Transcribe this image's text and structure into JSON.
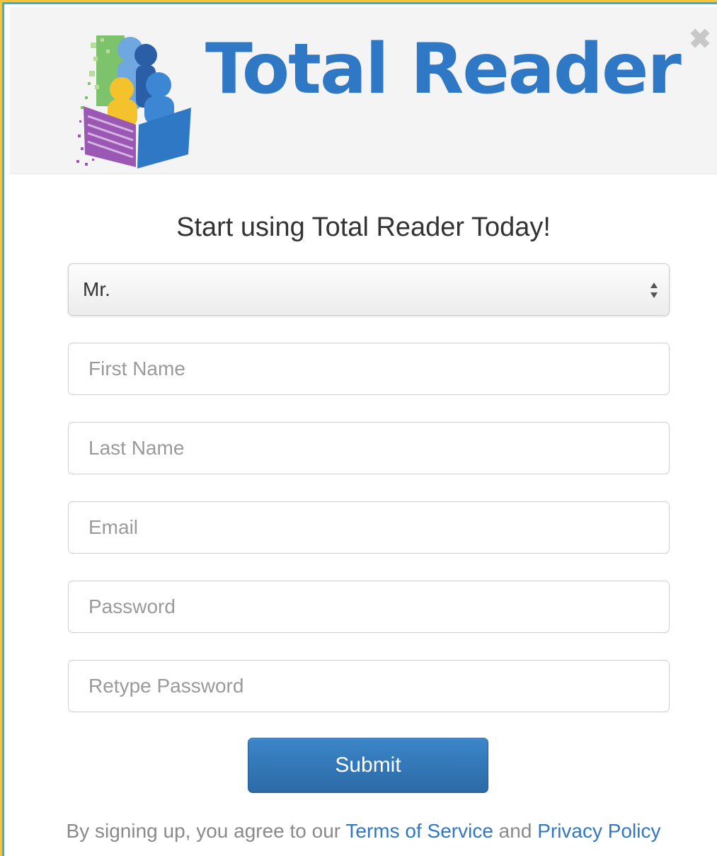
{
  "header": {
    "logo_text": "Total Reader",
    "close_symbol": "✖",
    "close_icon": "close-icon"
  },
  "form": {
    "title": "Start using Total Reader Today!",
    "salutation": {
      "selected": "Mr."
    },
    "fields": {
      "first_name": {
        "placeholder": "First Name",
        "value": ""
      },
      "last_name": {
        "placeholder": "Last Name",
        "value": ""
      },
      "email": {
        "placeholder": "Email",
        "value": ""
      },
      "password": {
        "placeholder": "Password",
        "value": ""
      },
      "retype_password": {
        "placeholder": "Retype Password",
        "value": ""
      }
    },
    "submit_label": "Submit"
  },
  "footer": {
    "prefix": "By signing up, you agree to our ",
    "terms_link": "Terms of Service",
    "connector": " and ",
    "privacy_link": "Privacy Policy"
  },
  "colors": {
    "brand_blue": "#2f78c5",
    "button_blue": "#2c6aa6",
    "outer_border": "#f5c542",
    "inner_border": "#2ab3e6"
  }
}
